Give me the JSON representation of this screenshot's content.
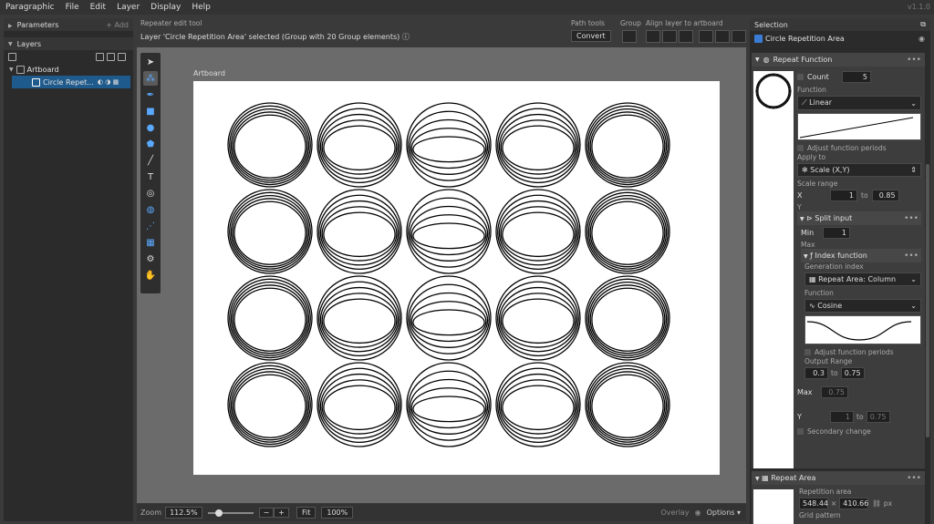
{
  "menu": [
    "Paragraphic",
    "File",
    "Edit",
    "Layer",
    "Display",
    "Help"
  ],
  "version": "v1.1.0",
  "left": {
    "parameters_label": "Parameters",
    "add_label": "+ Add",
    "layers_label": "Layers",
    "artboard_label": "Artboard",
    "layer_name": "Circle Repet..."
  },
  "toolbar": {
    "tool_name": "Repeater edit tool",
    "status": "Layer 'Circle Repetition Area' selected (Group with 20 Group elements)",
    "path_tools": "Path tools",
    "convert": "Convert",
    "group": "Group",
    "align": "Align layer to artboard"
  },
  "canvas": {
    "artboard_label": "Artboard",
    "rows": 4,
    "cols": 5
  },
  "bottom": {
    "zoom_label": "Zoom",
    "zoom_value": "112.5%",
    "fit": "Fit",
    "hundred": "100%",
    "overlay": "Overlay",
    "options": "Options"
  },
  "right": {
    "selection": "Selection",
    "layer_name": "Circle Repetition Area",
    "repeat_function": "Repeat Function",
    "count_label": "Count",
    "count_value": "5",
    "function_label": "Function",
    "function_value": "Linear",
    "adjust_periods": "Adjust function periods",
    "apply_to": "Apply to",
    "apply_value": "Scale (X,Y)",
    "scale_range": "Scale range",
    "x_label": "X",
    "x_from": "1",
    "to": "to",
    "x_to": "0.85",
    "y_label": "Y",
    "split_input": "Split input",
    "min_label": "Min",
    "min_value": "1",
    "max_label": "Max",
    "index_function": "Index function",
    "gen_index": "Generation index",
    "gen_value": "Repeat Area: Column",
    "func2_label": "Function",
    "func2_value": "Cosine",
    "adjust2": "Adjust function periods",
    "output_range": "Output Range",
    "out_from": "0.3",
    "out_to": "0.75",
    "max2_label": "Max",
    "max2_value": "0.75",
    "y2_label": "Y",
    "y2_from": "1",
    "y2_to": "0.75",
    "secondary": "Secondary change",
    "repeat_area": "Repeat Area",
    "rep_area_label": "Repetition area",
    "rep_w": "548.44",
    "rep_h": "410.66",
    "px": "px",
    "grid_pattern": "Grid pattern"
  }
}
